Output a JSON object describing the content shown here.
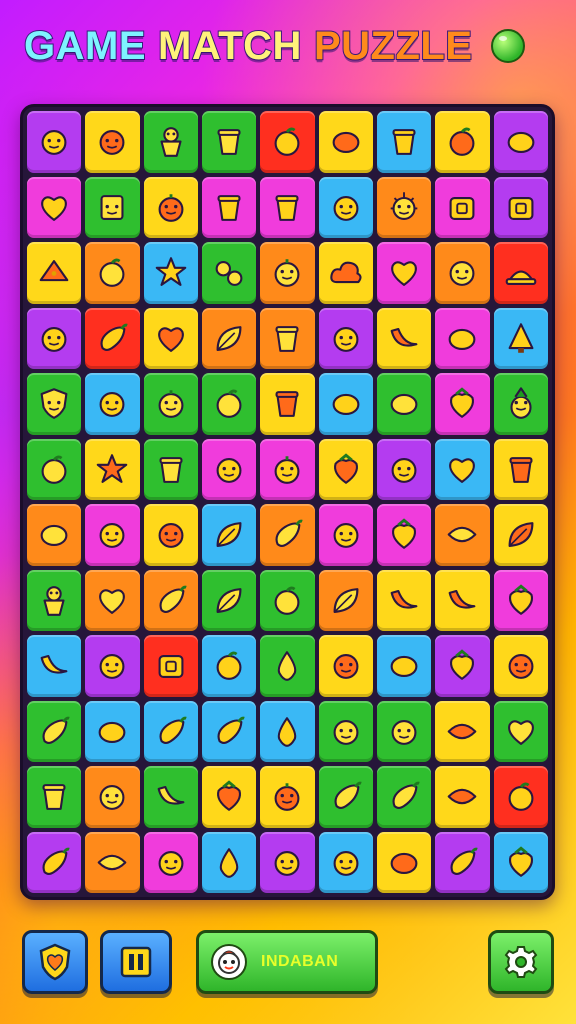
{
  "header": {
    "title_words": [
      "GAME",
      "MATCH",
      "PUZZLE"
    ],
    "title_ball_icon": "green-ball-icon"
  },
  "colors": {
    "purple": "#b43cf0",
    "yellow": "#ffd81a",
    "green": "#2fbf2f",
    "red": "#ff2f1f",
    "blue": "#3ab8f5",
    "magenta": "#f03cdc",
    "orange": "#ff8a1a",
    "lime": "#9be32a"
  },
  "board": {
    "rows": 12,
    "cols": 9,
    "tiles": [
      [
        "purple:smiley-fruit",
        "yellow:face-blob",
        "green:gingerbread",
        "green:jar",
        "red:tomato",
        "yellow:lemon",
        "blue:cup",
        "yellow:apple",
        "purple:lemon"
      ],
      [
        "magenta:heart",
        "green:robot-face",
        "yellow:pumpkin",
        "magenta:jar",
        "magenta:cup",
        "blue:frog-face",
        "orange:sun-face",
        "magenta:cake",
        "purple:basket"
      ],
      [
        "yellow:cheese",
        "orange:apple",
        "blue:star",
        "green:peas",
        "orange:orange",
        "yellow:cloud",
        "magenta:heart",
        "orange:smiley-face",
        "red:hat"
      ],
      [
        "purple:smiley-face",
        "red:eggplant",
        "yellow:heart",
        "orange:palm",
        "orange:jar",
        "purple:pepper",
        "yellow:banana",
        "magenta:lemon",
        "blue:tree"
      ],
      [
        "green:shield",
        "blue:smiley-drop",
        "green:pumpkin",
        "green:apple",
        "yellow:jar",
        "blue:egg",
        "green:lemon",
        "magenta:strawberry",
        "green:pineapple"
      ],
      [
        "green:apple",
        "yellow:star",
        "green:cup",
        "magenta:smiley-face",
        "magenta:orange",
        "yellow:berry",
        "purple:smiley-face",
        "blue:heart",
        "yellow:cup"
      ],
      [
        "orange:lemon",
        "magenta:smiley-face",
        "yellow:pepper",
        "blue:leaf",
        "orange:carrot",
        "magenta:smiley-face",
        "magenta:radish",
        "orange:bread",
        "yellow:leaf"
      ],
      [
        "green:gingerbread",
        "orange:heart",
        "orange:eggplant",
        "green:broccoli",
        "green:tomato",
        "orange:leaf",
        "yellow:banana",
        "yellow:banana",
        "magenta:radish"
      ],
      [
        "blue:banana",
        "purple:frog-face",
        "red:box",
        "blue:apple",
        "green:pear",
        "yellow:smiley-face",
        "blue:lemon",
        "purple:berry",
        "yellow:pepper"
      ],
      [
        "green:chili",
        "blue:lemon",
        "blue:chili",
        "blue:carrot",
        "blue:drop",
        "green:smiley-face",
        "green:face-blob",
        "yellow:lips",
        "green:heart"
      ],
      [
        "green:cup",
        "orange:smiley-fruit",
        "green:banana",
        "yellow:strawberry",
        "yellow:orange",
        "green:chili",
        "green:chili",
        "yellow:fish",
        "red:tomato"
      ],
      [
        "purple:eggplant",
        "orange:bread",
        "magenta:smiley-fruit",
        "blue:pear",
        "purple:smiley-fruit",
        "blue:smiley-face",
        "yellow:lemon",
        "purple:carrot",
        "blue:strawberry"
      ]
    ]
  },
  "controls": {
    "hint_icon": "heart-shield-icon",
    "pause_icon": "pause-icon",
    "player_avatar_icon": "tomato-face-icon",
    "player_name": "INDABAN",
    "settings_icon": "gear-icon"
  }
}
